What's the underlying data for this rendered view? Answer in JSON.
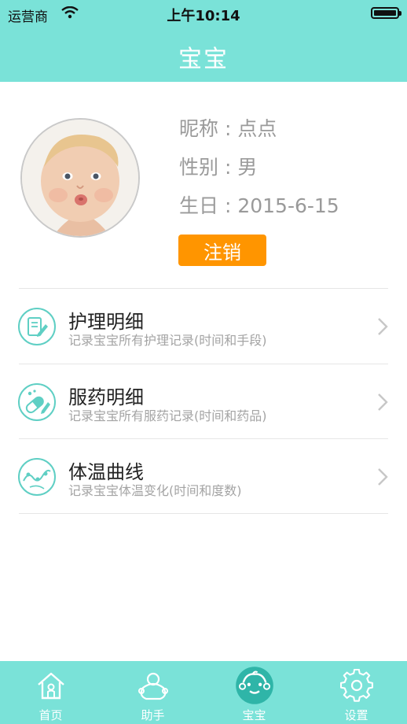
{
  "status_bar": {
    "carrier": "运营商",
    "time": "上午10:14"
  },
  "nav": {
    "title": "宝宝"
  },
  "profile": {
    "nickname": "昵称 : 点点",
    "gender": "性别 : 男",
    "birthday": "生日 : 2015-6-15",
    "logout_label": "注销"
  },
  "menu": {
    "items": [
      {
        "title": "护理明细",
        "subtitle": "记录宝宝所有护理记录(时间和手段)",
        "icon": "nursing-notebook-icon"
      },
      {
        "title": "服药明细",
        "subtitle": "记录宝宝所有服药记录(时间和药品)",
        "icon": "medicine-capsule-icon"
      },
      {
        "title": "体温曲线",
        "subtitle": "记录宝宝体温变化(时间和度数)",
        "icon": "temperature-curve-icon"
      }
    ]
  },
  "tabs": [
    {
      "label": "首页",
      "icon": "home-icon"
    },
    {
      "label": "助手",
      "icon": "assistant-icon"
    },
    {
      "label": "宝宝",
      "icon": "baby-face-icon",
      "active": true
    },
    {
      "label": "设置",
      "icon": "settings-gear-icon"
    }
  ],
  "colors": {
    "accent": "#7ae2d8",
    "icon_teal": "#5fcfc4",
    "logout": "#ff9500",
    "text_gray": "#9a9a9a"
  }
}
